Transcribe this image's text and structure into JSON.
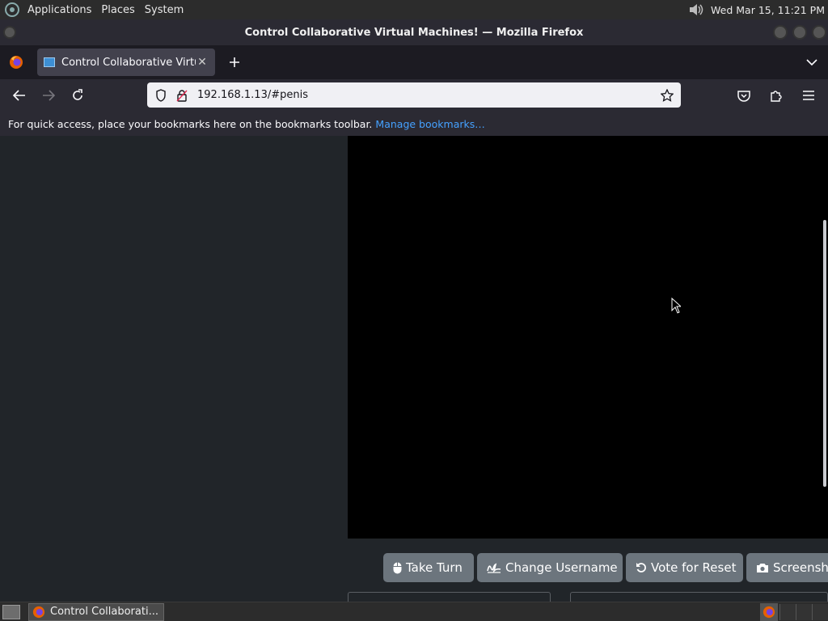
{
  "top_panel": {
    "menus": [
      "Applications",
      "Places",
      "System"
    ],
    "clock": "Wed Mar 15, 11:21 PM"
  },
  "window": {
    "title": "Control Collaborative Virtual Machines! — Mozilla Firefox"
  },
  "tabs": [
    {
      "label": "Control Collaborative Virtua",
      "active": true
    }
  ],
  "navbar": {
    "url": "192.168.1.13/#penis"
  },
  "bookmarks_toolbar": {
    "message": "For quick access, place your bookmarks here on the bookmarks toolbar.",
    "link": "Manage bookmarks…"
  },
  "vm_controls": {
    "take_turn": "Take Turn",
    "change_username": "Change Username",
    "vote_reset": "Vote for Reset",
    "screenshot": "Screensho"
  },
  "taskbar": {
    "task_label": "Control Collaborati..."
  },
  "colors": {
    "page_bg": "#212529",
    "button_bg": "#6c757d",
    "link": "#45a1ff",
    "vm_screen": "#000000"
  }
}
